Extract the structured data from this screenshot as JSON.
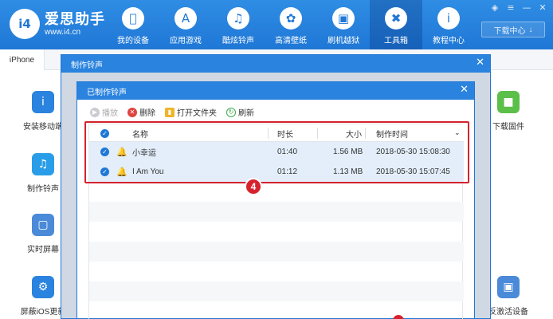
{
  "app": {
    "logo_badge": "i4",
    "name": "爱思助手",
    "url": "www.i4.cn"
  },
  "nav": [
    {
      "label": "我的设备",
      "icon": "apple-icon"
    },
    {
      "label": "应用游戏",
      "icon": "app-store-icon"
    },
    {
      "label": "酷炫铃声",
      "icon": "bell-icon"
    },
    {
      "label": "高清壁纸",
      "icon": "flower-icon"
    },
    {
      "label": "刷机越狱",
      "icon": "box-icon"
    },
    {
      "label": "工具箱",
      "icon": "tools-icon",
      "active": true
    },
    {
      "label": "教程中心",
      "icon": "info-icon"
    }
  ],
  "download_center": "下载中心",
  "bg": {
    "tab": "iPhone",
    "tools_left": [
      {
        "label": "安装移动端",
        "color": "#2a83de",
        "icon": "i4-icon"
      },
      {
        "label": "制作铃声",
        "color": "#2a9de8",
        "icon": "bell-icon"
      },
      {
        "label": "实时屏幕",
        "color": "#4b8ad8",
        "icon": "monitor-icon"
      },
      {
        "label": "屏蔽iOS更新",
        "color": "#2a83de",
        "icon": "gear-icon"
      }
    ],
    "tools_right": [
      {
        "label": "下载固件",
        "color": "#5cbf4a",
        "icon": "cube-icon"
      },
      {
        "label": "反激活设备",
        "color": "#4b8ad8",
        "icon": "phone-icon"
      }
    ]
  },
  "outer_dialog": {
    "title": "制作铃声"
  },
  "inner_dialog": {
    "title": "已制作铃声",
    "toolbar": {
      "play": "播放",
      "delete": "删除",
      "open_folder": "打开文件夹",
      "refresh": "刷新"
    },
    "columns": {
      "name": "名称",
      "duration": "时长",
      "size": "大小",
      "created": "制作时间"
    },
    "rows": [
      {
        "name": "小幸运",
        "duration": "01:40",
        "size": "1.56 MB",
        "created": "2018-05-30 15:08:30"
      },
      {
        "name": "I Am You",
        "duration": "01:12",
        "size": "1.13 MB",
        "created": "2018-05-30 15:07:45"
      }
    ]
  },
  "step_badge": "4",
  "colors": {
    "brand": "#1f77d6",
    "highlight": "#d6222e",
    "selected_row": "#e3eefa"
  }
}
